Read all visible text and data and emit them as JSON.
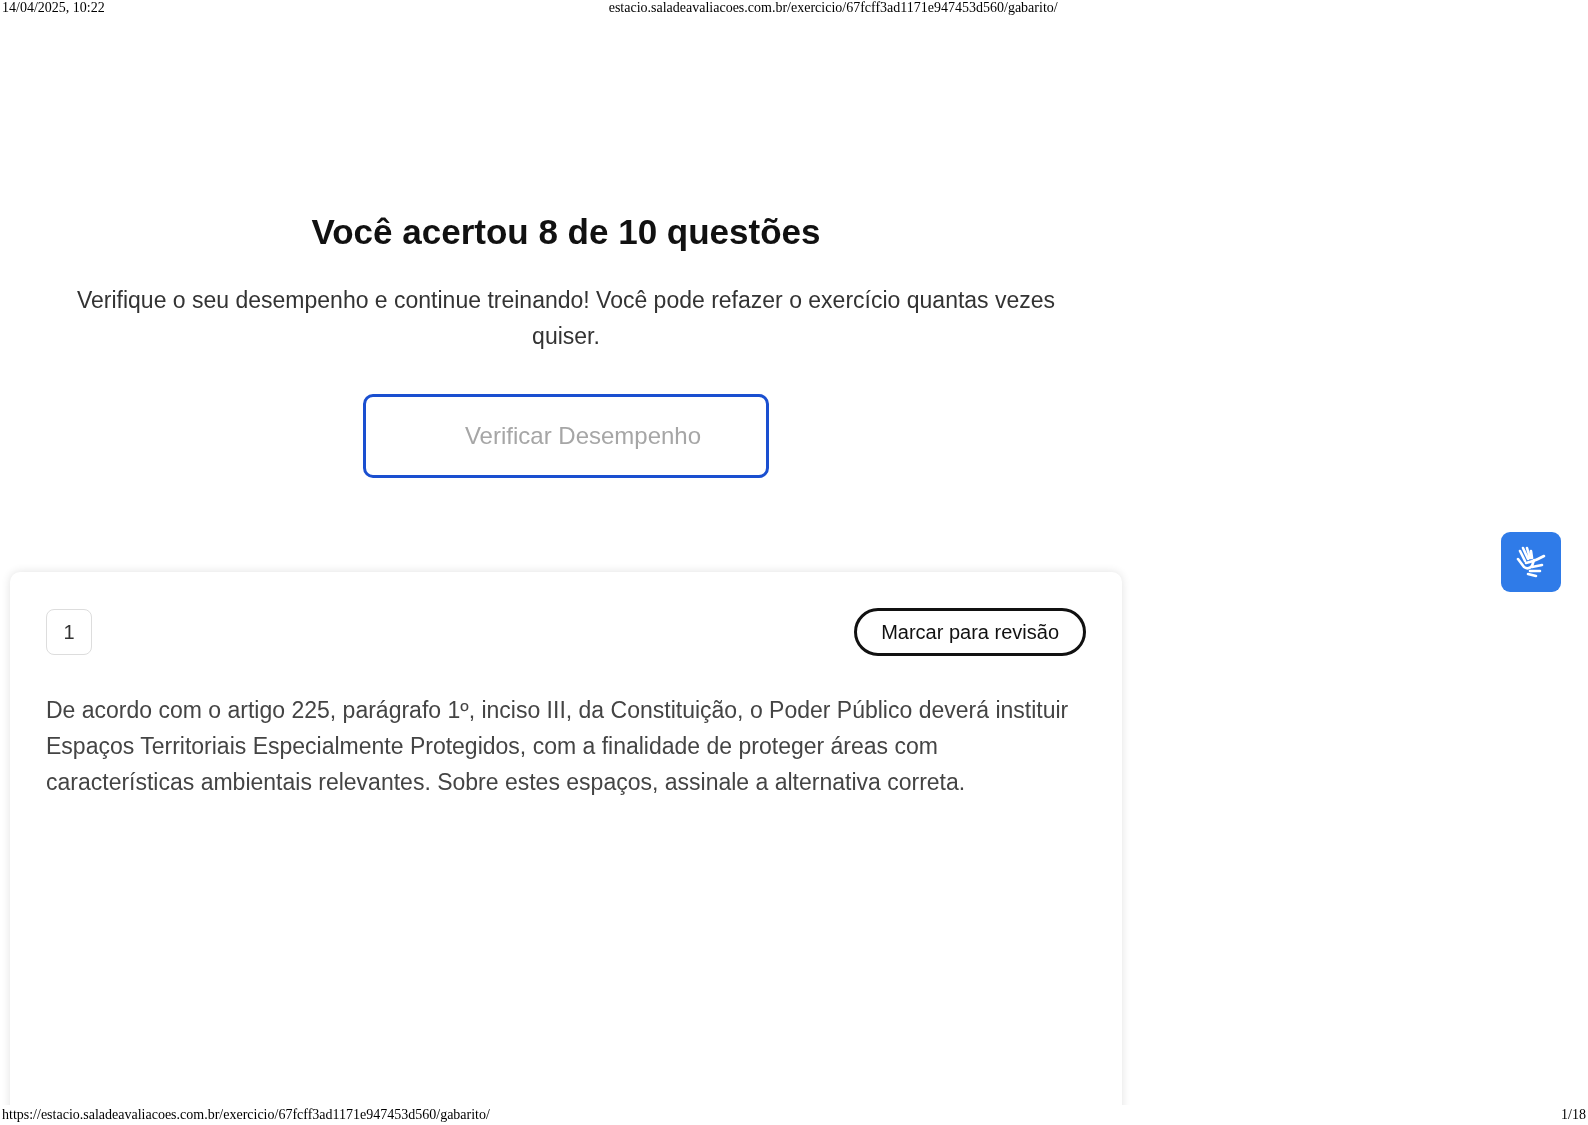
{
  "print_header": {
    "datetime": "14/04/2025, 10:22",
    "url": "estacio.saladeavaliacoes.com.br/exercicio/67fcff3ad1171e947453d560/gabarito/"
  },
  "result": {
    "title": "Você acertou 8 de 10 questões",
    "message": "Verifique o seu desempenho e continue treinando! Você pode refazer o exercício quantas vezes quiser.",
    "button": "Verificar Desempenho"
  },
  "question": {
    "number": "1",
    "review_button": "Marcar para revisão",
    "text": "De acordo com o artigo 225, parágrafo 1º, inciso III, da Constituição, o Poder Público deverá instituir Espaços Territoriais Especialmente Protegidos, com a finalidade de proteger áreas com características ambientais relevantes. Sobre estes espaços, assinale a alternativa correta."
  },
  "print_footer": {
    "url": "https://estacio.saladeavaliacoes.com.br/exercicio/67fcff3ad1171e947453d560/gabarito/",
    "page": "1/18"
  }
}
